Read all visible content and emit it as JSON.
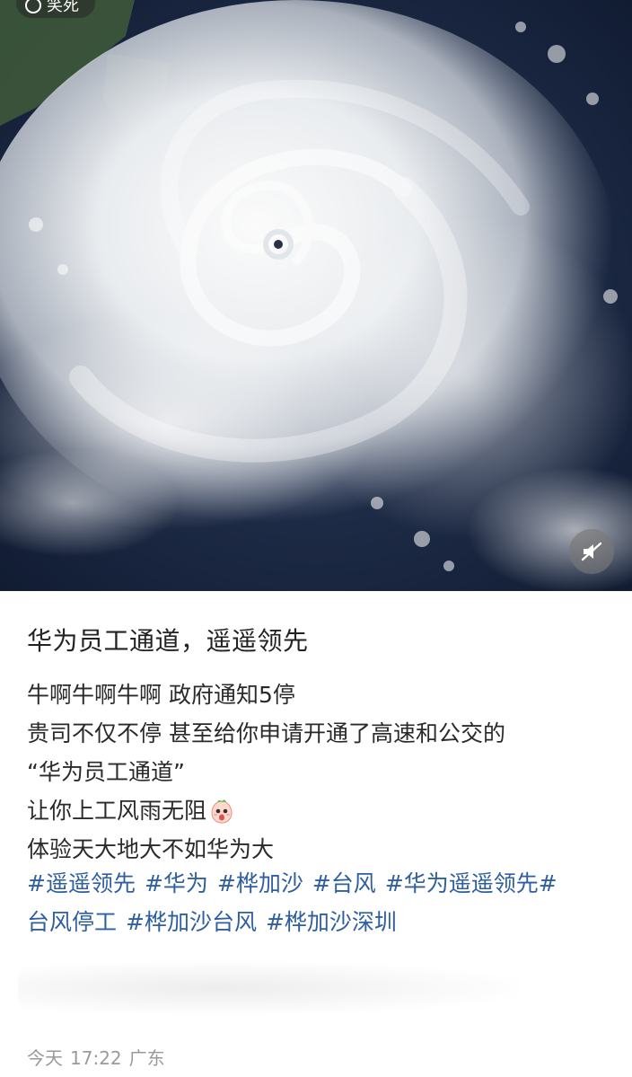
{
  "hero": {
    "image_subject": "typhoon-satellite-photo",
    "chip_label": "笑死",
    "mute_icon": "speaker-muted-icon"
  },
  "post": {
    "title": "华为员工通道，遥遥领先",
    "lines": [
      "牛啊牛啊牛啊 政府通知5停",
      "贵司不仅不停 甚至给你申请开通了高速和公交的",
      "“华为员工通道”",
      "让你上工风雨无阻",
      "体验天大地大不如华为大"
    ],
    "emoji_icon": "surprised-face-emoji-icon",
    "hashtags": [
      "#遥遥领先",
      "#华为",
      "#桦加沙",
      "#台风",
      "#华为遥遥领先#",
      "台风停工",
      "#桦加沙台风",
      "#桦加沙深圳"
    ]
  },
  "meta": {
    "date": "今天",
    "time": "17:22",
    "location": "广东"
  },
  "colors": {
    "hashtag": "#2f5f9e",
    "text": "#2a2a2a",
    "meta": "#9a9a9a"
  }
}
